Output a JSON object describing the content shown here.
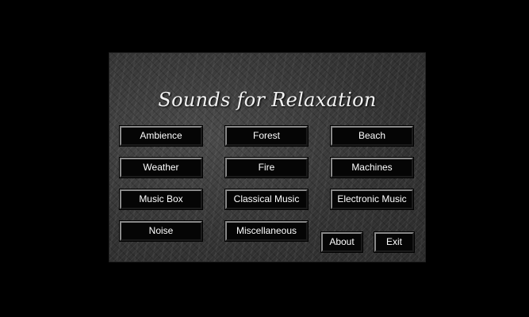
{
  "app": {
    "title": "Sounds for Relaxation"
  },
  "categories": {
    "ambience": "Ambience",
    "forest": "Forest",
    "beach": "Beach",
    "weather": "Weather",
    "fire": "Fire",
    "machines": "Machines",
    "music_box": "Music Box",
    "classical_music": "Classical Music",
    "electronic_music": "Electronic Music",
    "noise": "Noise",
    "miscellaneous": "Miscellaneous"
  },
  "actions": {
    "about": "About",
    "exit": "Exit"
  }
}
